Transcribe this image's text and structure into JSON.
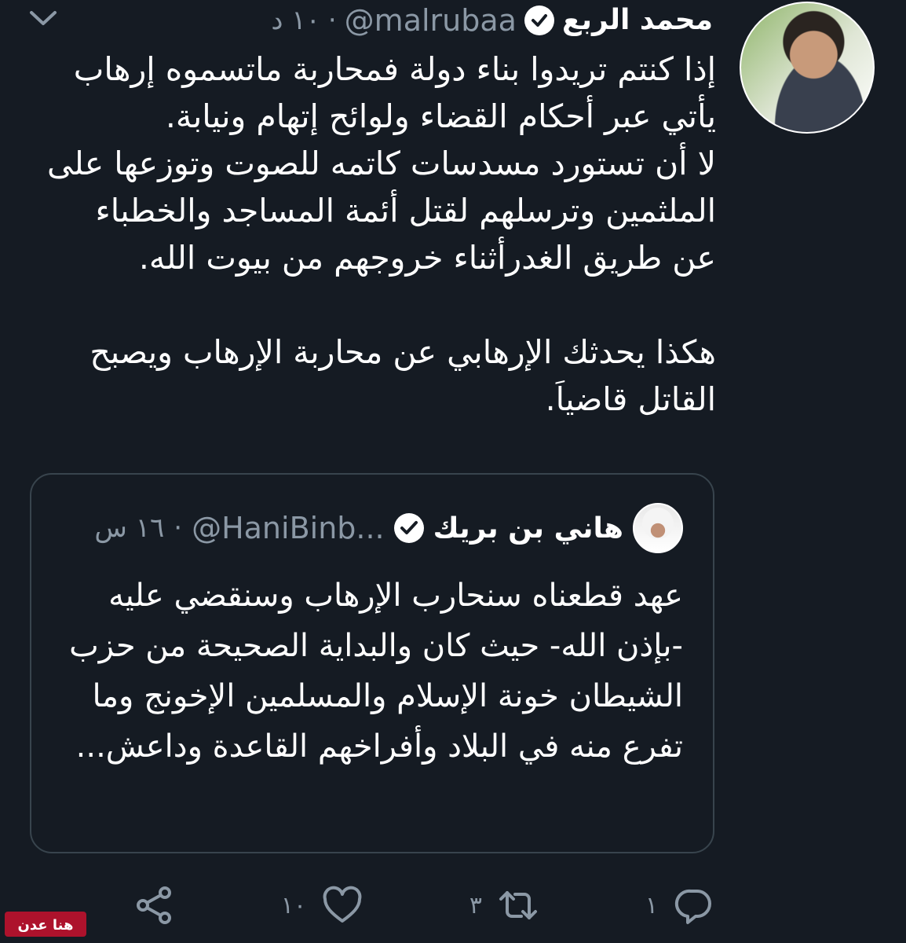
{
  "tweet": {
    "display_name": "محمد الربع",
    "handle": "@malrubaa",
    "separator": "·",
    "time": "١٠ د",
    "paragraphs": [
      "إذا كنتم تريدوا بناء دولة فمحاربة ماتسموه إرهاب يأتي عبر أحكام القضاء ولوائح إتهام ونيابة.",
      "لا أن تستورد مسدسات كاتمه للصوت وتوزعها على الملثمين وترسلهم لقتل أئمة المساجد والخطباء عن طريق الغدرأثناء خروجهم من بيوت الله.",
      "هكذا يحدثك الإرهابي عن محاربة الإرهاب ويصبح القاتل قاضياَ."
    ]
  },
  "quoted_tweet": {
    "display_name": "هاني بن بريك",
    "handle": "@HaniBinb...",
    "separator": "·",
    "time": "١٦ س",
    "text": "عهد قطعناه سنحارب الإرهاب وسنقضي عليه -بإذن الله- حيث كان والبداية الصحيحة من حزب الشيطان خونة الإسلام والمسلمين الإخونج وما تفرع منه في البلاد وأفراخهم القاعدة وداعش..."
  },
  "actions": {
    "reply_count": "١",
    "retweet_count": "٣",
    "like_count": "١٠",
    "icons": [
      "reply-icon",
      "retweet-icon",
      "like-icon",
      "share-icon"
    ]
  },
  "watermark": {
    "text": "هنا عدن"
  },
  "colors": {
    "background": "#151b23",
    "text": "#ffffff",
    "muted": "#8b98a5",
    "border": "#38444d",
    "watermark": "#c8102e"
  }
}
